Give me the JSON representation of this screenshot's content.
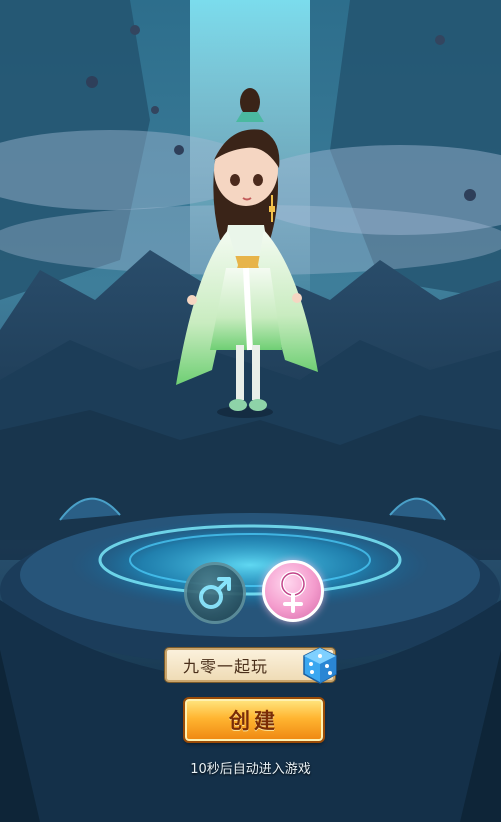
{
  "gender": {
    "male_symbol": "♂",
    "female_symbol": "♀",
    "selected": "female"
  },
  "character_name": "九零一起玩",
  "create_button": {
    "label": "创建"
  },
  "countdown_text": "10秒后自动进入游戏",
  "icons": {
    "dice": "dice-icon",
    "male": "male-icon",
    "female": "female-icon"
  },
  "colors": {
    "female_pink": "#f49ccd",
    "create_orange": "#ffb531",
    "platform_glow": "#3fd0ff"
  }
}
